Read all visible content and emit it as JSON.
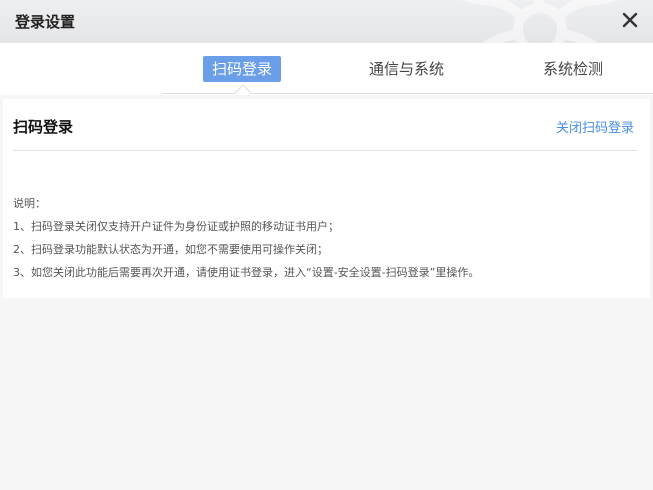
{
  "window": {
    "title": "登录设置"
  },
  "tabs": [
    {
      "label": "扫码登录",
      "active": true
    },
    {
      "label": "通信与系统",
      "active": false
    },
    {
      "label": "系统检测",
      "active": false
    }
  ],
  "panel": {
    "title": "扫码登录",
    "action_link": "关闭扫码登录",
    "notes_heading": "说明：",
    "notes": [
      "1、扫码登录关闭仅支持开户证件为身份证或护照的移动证书用户；",
      "2、扫码登录功能默认状态为开通，如您不需要使用可操作关闭；",
      "3、如您关闭此功能后需要再次开通，请使用证书登录，进入“设置-安全设置-扫码登录”里操作。"
    ]
  },
  "colors": {
    "accent": "#6a9ee8",
    "link": "#4a8ee6"
  },
  "icons": {
    "close": "close-icon"
  }
}
